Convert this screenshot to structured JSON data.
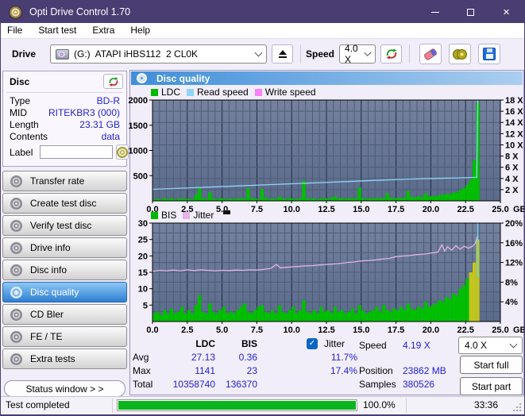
{
  "window": {
    "title": "Opti Drive Control 1.70"
  },
  "menu": {
    "items": [
      {
        "label": "File"
      },
      {
        "label": "Start test"
      },
      {
        "label": "Extra"
      },
      {
        "label": "Help"
      }
    ]
  },
  "toolbar": {
    "drive_label": "Drive",
    "drive_value": "(G:)  ATAPI iHBS112  2 CL0K",
    "speed_label": "Speed",
    "speed_value": "4.0 X"
  },
  "disc_panel": {
    "title": "Disc",
    "rows": [
      {
        "label": "Type",
        "value": "BD-R"
      },
      {
        "label": "MID",
        "value": "RITEKBR3 (000)"
      },
      {
        "label": "Length",
        "value": "23.31 GB"
      },
      {
        "label": "Contents",
        "value": "data"
      }
    ],
    "label_label": "Label",
    "label_value": ""
  },
  "sidebar": {
    "buttons": [
      {
        "label": "Transfer rate"
      },
      {
        "label": "Create test disc"
      },
      {
        "label": "Verify test disc"
      },
      {
        "label": "Drive info"
      },
      {
        "label": "Disc info"
      },
      {
        "label": "Disc quality"
      },
      {
        "label": "CD Bler"
      },
      {
        "label": "FE / TE"
      },
      {
        "label": "Extra tests"
      }
    ],
    "status_window": "Status window > >"
  },
  "main": {
    "header": "Disc quality"
  },
  "stats": {
    "col_ldc": "LDC",
    "col_bis": "BIS",
    "jitter_label": "Jitter",
    "rows": [
      {
        "label": "Avg",
        "ldc": "27.13",
        "bis": "0.36",
        "jitter": "11.7%"
      },
      {
        "label": "Max",
        "ldc": "1141",
        "bis": "23",
        "jitter": "17.4%"
      },
      {
        "label": "Total",
        "ldc": "10358740",
        "bis": "136370",
        "jitter": ""
      }
    ],
    "speed_label": "Speed",
    "speed_value": "4.19 X",
    "position_label": "Position",
    "position_value": "23862 MB",
    "samples_label": "Samples",
    "samples_value": "380526",
    "speed_select": "4.0 X",
    "start_full": "Start full",
    "start_part": "Start part"
  },
  "statusbar": {
    "status_text": "Test completed",
    "percent": "100.0%",
    "time": "33:36"
  },
  "colors": {
    "titlebar": "#4a3d72",
    "accent_blue": "#2222cc",
    "selected_button": "#2e7fd2",
    "progress_green": "#0cb41e",
    "plot_bg": "#66759a"
  },
  "chart_data": [
    {
      "type": "bar",
      "title": "Disc quality",
      "x_unit": "GB",
      "x_min": 0,
      "x_max": 25,
      "x_ticks": [
        0,
        2.5,
        5,
        7.5,
        10,
        12.5,
        15,
        17.5,
        20,
        22.5,
        25
      ],
      "left_axis": {
        "label": "LDC",
        "min": 0,
        "max": 2000,
        "ticks": [
          500,
          1000,
          1500,
          2000
        ],
        "suffix": ""
      },
      "right_axis": {
        "label": "Read speed",
        "min": 0,
        "max": 18,
        "ticks": [
          2,
          4,
          6,
          8,
          10,
          12,
          14,
          16,
          18
        ],
        "suffix": " X"
      },
      "grid": {
        "v_minor": 0.5,
        "v_major": 2.5,
        "h_divisions": 9
      },
      "legend": [
        {
          "label": "LDC",
          "color": "#00b800"
        },
        {
          "label": "Read speed",
          "color": "#8fd6f7"
        },
        {
          "label": "Write speed",
          "color": "#fb81fb"
        }
      ],
      "bars": {
        "name": "LDC",
        "axis": "left",
        "color": "#00bf00",
        "x_start": 0,
        "x_step": 0.25,
        "values": [
          30,
          45,
          25,
          60,
          35,
          50,
          30,
          40,
          55,
          35,
          45,
          30,
          120,
          260,
          60,
          40,
          170,
          50,
          35,
          55,
          40,
          30,
          50,
          35,
          45,
          60,
          40,
          250,
          55,
          45,
          35,
          230,
          60,
          40,
          50,
          35,
          80,
          50,
          40,
          55,
          45,
          35,
          60,
          400,
          55,
          40,
          50,
          35,
          45,
          55,
          40,
          60,
          90,
          45,
          55,
          40,
          50,
          60,
          45,
          260,
          55,
          40,
          50,
          45,
          60,
          50,
          55,
          150,
          60,
          50,
          65,
          55,
          70,
          200,
          80,
          65,
          90,
          75,
          150,
          85,
          100,
          90,
          120,
          110,
          140,
          130,
          170,
          160,
          220,
          250,
          320,
          420,
          800,
          1950
        ]
      },
      "lines": [
        {
          "name": "Read speed",
          "axis": "right",
          "color": "#8fd6f7",
          "points": [
            [
              0,
              2.05
            ],
            [
              2,
              2.25
            ],
            [
              4,
              2.45
            ],
            [
              6,
              2.65
            ],
            [
              8,
              2.85
            ],
            [
              10,
              3.05
            ],
            [
              12,
              3.25
            ],
            [
              14,
              3.45
            ],
            [
              16,
              3.65
            ],
            [
              18,
              3.85
            ],
            [
              20,
              4.0
            ],
            [
              22,
              4.1
            ],
            [
              23.3,
              4.19
            ],
            [
              23.38,
              18
            ]
          ]
        }
      ]
    },
    {
      "type": "bar",
      "title": "BIS / Jitter",
      "x_unit": "GB",
      "x_min": 0,
      "x_max": 25,
      "x_ticks": [
        0,
        2.5,
        5,
        7.5,
        10,
        12.5,
        15,
        17.5,
        20,
        22.5,
        25
      ],
      "left_axis": {
        "label": "BIS",
        "min": 0,
        "max": 30,
        "ticks": [
          5,
          10,
          15,
          20,
          25,
          30
        ],
        "suffix": ""
      },
      "right_axis": {
        "label": "Jitter",
        "min": 0,
        "max": 20,
        "ticks": [
          4,
          8,
          12,
          16,
          20
        ],
        "suffix": "%"
      },
      "grid": {
        "v_minor": 0.5,
        "v_major": 2.5,
        "h_divisions": 10
      },
      "legend": [
        {
          "label": "BIS",
          "color": "#00b800"
        },
        {
          "label": "Jitter",
          "color": "#e4b2e4"
        }
      ],
      "bars": {
        "name": "BIS",
        "axis": "left",
        "color": "#00bf00",
        "x_start": 0,
        "x_step": 0.25,
        "highlight_from": 22.6,
        "highlight_color": "#c2c61e",
        "values": [
          2.5,
          3,
          2,
          3.5,
          2.5,
          4,
          2.5,
          3,
          4.5,
          2.5,
          3.5,
          2.5,
          5,
          8,
          3,
          2.5,
          5.5,
          3,
          2.5,
          3.5,
          4.5,
          2.5,
          3,
          2.5,
          3.5,
          4.5,
          5.5,
          3,
          2.5,
          3.5,
          4.5,
          5,
          3,
          2.5,
          3.5,
          2.5,
          5,
          3,
          2.5,
          3.5,
          4.5,
          2.5,
          3.5,
          6.5,
          3,
          2.5,
          3.5,
          2.5,
          4.5,
          3,
          3.5,
          2.5,
          4.5,
          3,
          3.5,
          2.5,
          3,
          4,
          2.5,
          5,
          3.5,
          2.5,
          3,
          3.5,
          4.5,
          3,
          5,
          3.5,
          3,
          4,
          3.5,
          4.5,
          3.5,
          5.5,
          4,
          3.5,
          4.5,
          4,
          6,
          4.5,
          5,
          5.5,
          6.5,
          6,
          7.5,
          7,
          8.5,
          8,
          10,
          11,
          13,
          15,
          18,
          25
        ]
      },
      "lines": [
        {
          "name": "Jitter",
          "axis": "right",
          "color": "#e4b2e4",
          "points": [
            [
              0,
              10.2
            ],
            [
              0.5,
              10.4
            ],
            [
              1,
              10.3
            ],
            [
              1.5,
              10.45
            ],
            [
              2,
              10.3
            ],
            [
              2.5,
              10.5
            ],
            [
              3,
              10.35
            ],
            [
              3.5,
              10.5
            ],
            [
              4,
              10.4
            ],
            [
              4.5,
              10.3
            ],
            [
              5,
              10.4
            ],
            [
              5.5,
              10.35
            ],
            [
              6,
              10.45
            ],
            [
              6.5,
              10.4
            ],
            [
              7,
              10.5
            ],
            [
              7.5,
              10.45
            ],
            [
              8,
              10.6
            ],
            [
              8.5,
              10.8
            ],
            [
              8.9,
              11.6
            ],
            [
              9.2,
              10.9
            ],
            [
              9.5,
              11
            ],
            [
              10,
              11.1
            ],
            [
              10.5,
              11.2
            ],
            [
              11,
              11.3
            ],
            [
              11.5,
              11.35
            ],
            [
              12,
              11.5
            ],
            [
              12.5,
              11.6
            ],
            [
              13,
              11.7
            ],
            [
              13.5,
              11.8
            ],
            [
              14,
              12
            ],
            [
              14.5,
              12.1
            ],
            [
              15,
              12.3
            ],
            [
              15.5,
              12.4
            ],
            [
              16,
              12.5
            ],
            [
              16.5,
              12.7
            ],
            [
              17,
              12.8
            ],
            [
              17.5,
              13.2
            ],
            [
              18,
              13.3
            ],
            [
              18.5,
              13.4
            ],
            [
              19,
              13.6
            ],
            [
              19.5,
              13.7
            ],
            [
              20,
              13.9
            ],
            [
              20.5,
              14.1
            ],
            [
              20.8,
              15.6
            ],
            [
              21,
              14.3
            ],
            [
              21.2,
              15.2
            ],
            [
              21.5,
              14.5
            ],
            [
              21.8,
              15.4
            ],
            [
              22.1,
              14.7
            ],
            [
              22.4,
              15.3
            ],
            [
              22.7,
              14.9
            ],
            [
              23,
              15.3
            ],
            [
              23.2,
              15.9
            ],
            [
              23.35,
              17.3
            ]
          ]
        },
        {
          "name": "end-marker",
          "axis": "right",
          "color": "#62d4f8",
          "points": [
            [
              23.38,
              20
            ],
            [
              23.38,
              9
            ]
          ]
        }
      ]
    }
  ]
}
